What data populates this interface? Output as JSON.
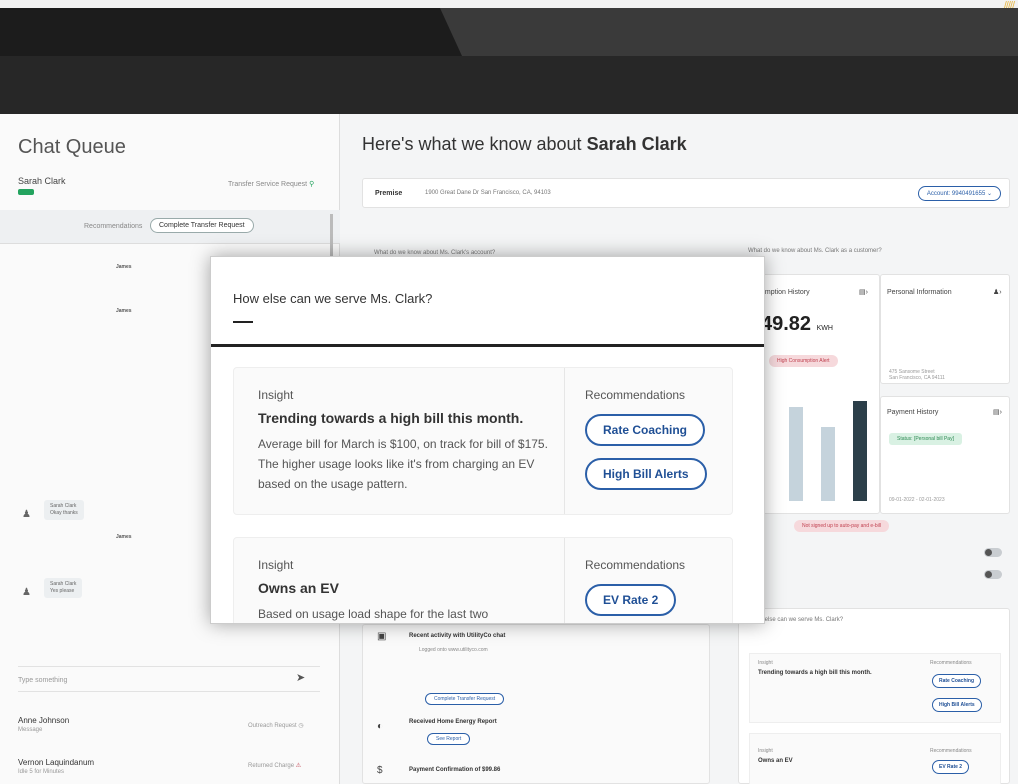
{
  "colors": {
    "accent": "#2b5fa8",
    "success": "#23a35e",
    "alert": "#c0404f",
    "dark_bar": "#1c1c1c"
  },
  "chat_queue": {
    "title": "Chat Queue",
    "current_user": "Sarah Clark",
    "transfer_link": "Transfer Service Request",
    "tabs": {
      "recommendations": "Recommendations",
      "complete": "Complete Transfer Request"
    },
    "messages": [
      {
        "author": "James"
      },
      {
        "author": "James"
      },
      {
        "author": "James"
      }
    ],
    "replies": [
      {
        "author": "Sarah Clark",
        "text": "Okay thanks"
      },
      {
        "author": "Sarah Clark",
        "text": "Yes please"
      }
    ],
    "input_placeholder": "Type something",
    "queue": [
      {
        "name": "Anne Johnson",
        "sub": "Message",
        "right": "Outreach Request"
      },
      {
        "name": "Vernon Laquindanum",
        "sub": "Idle 5 for Minutes",
        "right": "Returned Charge"
      }
    ]
  },
  "main": {
    "title_prefix": "Here's what we know about ",
    "title_name": "Sarah Clark",
    "premise_label": "Premise",
    "premise_value": "1900 Great Dane Dr San Francisco, CA, 94103",
    "account_label": "Account: 9940491655",
    "section_account": "What do we know about Ms. Clark's account?",
    "section_customer": "What do we know about Ms. Clark as a customer?",
    "consumption": {
      "title": "umption History",
      "value": "49.82",
      "unit": "KWH",
      "pill": "High Consumption Alert"
    },
    "personal_info": {
      "title": "Personal Information",
      "address_line1": "475 Sansome Street",
      "address_line2": "San Francisco, CA 94111"
    },
    "payment_history": {
      "title": "Payment History",
      "status": "Status: [Personal bill Pay]",
      "period": "09-01-2022 - 02-01-2023"
    },
    "enrollment_pill": "Not signed up to auto-pay and e-bill",
    "activity": [
      {
        "title": "Recent activity with UtilityCo chat",
        "sub": "Logged onto www.utilityco.com"
      },
      {
        "title": "Received Home Energy Report",
        "button": "See Report"
      },
      {
        "title": "Payment Confirmation of $99.86"
      }
    ],
    "activity_button": "Complete Transfer Request",
    "mini_insights_label": "How else can we serve Ms. Clark?"
  },
  "modal": {
    "title": "How else can we serve Ms. Clark?",
    "insights": [
      {
        "label": "Insight",
        "headline": "Trending towards a high bill this month.",
        "body": "Average bill for March is $100, on track for bill of $175. The higher usage looks like it's from charging an EV based on the usage pattern.",
        "rec_label": "Recommendations",
        "recommendations": [
          "Rate Coaching",
          "High Bill Alerts"
        ]
      },
      {
        "label": "Insight",
        "headline": "Owns an EV",
        "body": "Based on usage load shape for the last two",
        "rec_label": "Recommendations",
        "recommendations": [
          "EV Rate 2"
        ]
      }
    ]
  },
  "mini_cards": [
    {
      "label": "Insight",
      "headline": "Trending towards a high bill this month.",
      "rec_label": "Recommendations",
      "recommendations": [
        "Rate Coaching",
        "High Bill Alerts"
      ]
    },
    {
      "label": "Insight",
      "headline": "Owns an EV",
      "rec_label": "Recommendations",
      "recommendations": [
        "EV Rate 2"
      ]
    }
  ]
}
